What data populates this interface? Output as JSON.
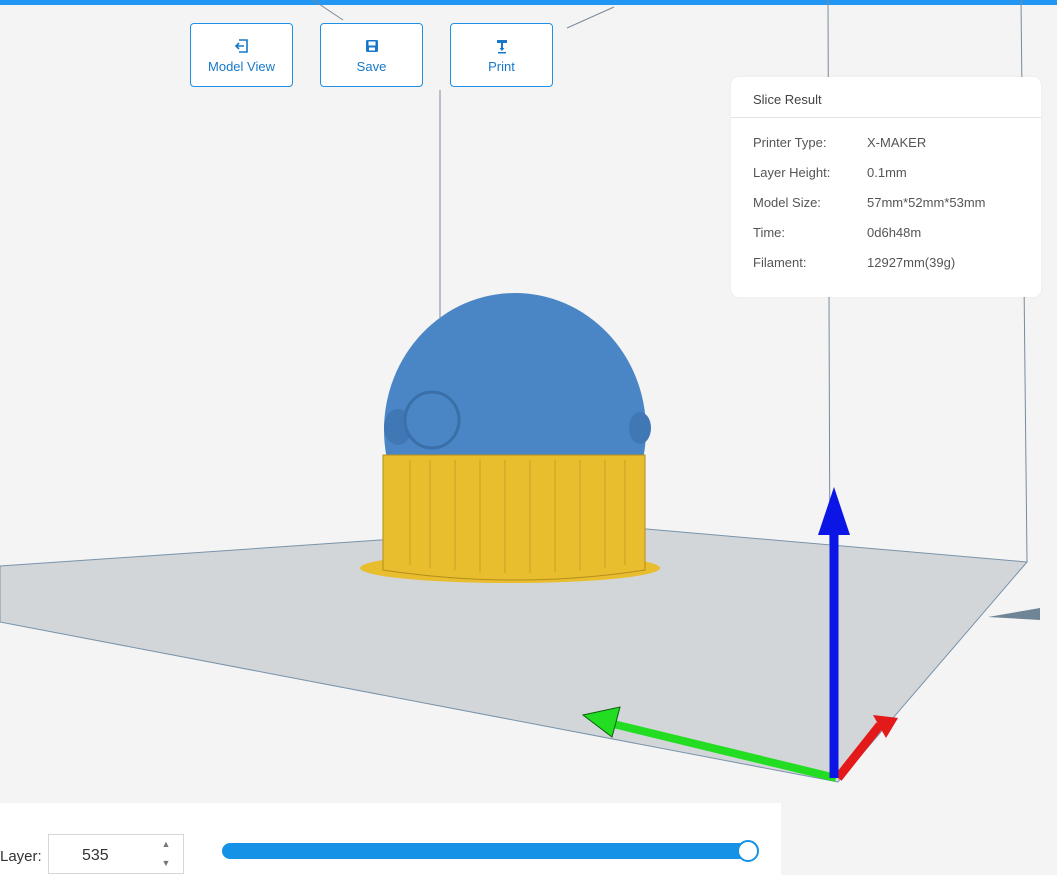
{
  "toolbar": {
    "model_view_label": "Model View",
    "save_label": "Save",
    "print_label": "Print"
  },
  "slice_result": {
    "title": "Slice Result",
    "rows": [
      {
        "label": "Printer Type:",
        "value": "X-MAKER"
      },
      {
        "label": "Layer Height:",
        "value": "0.1mm"
      },
      {
        "label": "Model Size:",
        "value": "57mm*52mm*53mm"
      },
      {
        "label": "Time:",
        "value": "0d6h48m"
      },
      {
        "label": "Filament:",
        "value": "12927mm(39g)"
      }
    ]
  },
  "layer_control": {
    "label": "Layer:",
    "value": "535",
    "slider_fraction": 1.0
  },
  "icons": {
    "model_view": "model-view-icon",
    "save": "save-icon",
    "print": "print-icon",
    "spin_up": "chevron-up-icon",
    "spin_down": "chevron-down-icon"
  },
  "colors": {
    "accent": "#1592e6",
    "model_top": "#4a86c5",
    "model_bottom": "#e8bd2e",
    "axis_z": "#0b16e6",
    "axis_x": "#e41a1a",
    "axis_y": "#22dd22",
    "build_plate": "#d3d6d8"
  }
}
